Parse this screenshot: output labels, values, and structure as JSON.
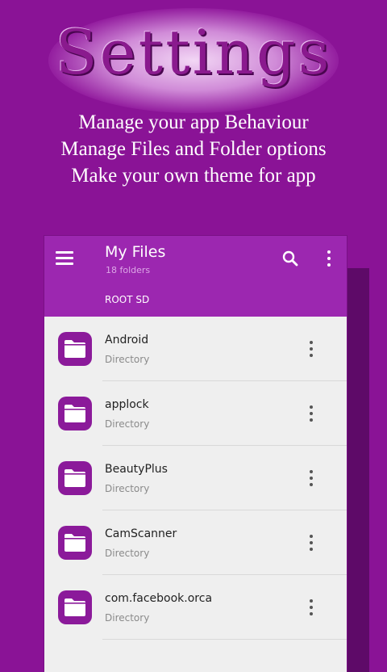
{
  "promo": {
    "title": "Settings",
    "lines": [
      "Manage your app Behaviour",
      "Manage Files and Folder options",
      "Make your own theme for app"
    ]
  },
  "appbar": {
    "title": "My Files",
    "subtitle": "18 folders",
    "breadcrumb": "ROOT SD",
    "icons": [
      "menu-icon",
      "search-icon",
      "more-vert-icon"
    ]
  },
  "colors": {
    "background": "#8a1396",
    "appbar": "#9c27b0",
    "folder_icon_bg": "#8b1a9a",
    "list_bg": "#efefef"
  },
  "files": [
    {
      "name": "Android",
      "type": "Directory"
    },
    {
      "name": "applock",
      "type": "Directory"
    },
    {
      "name": "BeautyPlus",
      "type": "Directory"
    },
    {
      "name": "CamScanner",
      "type": "Directory"
    },
    {
      "name": "com.facebook.orca",
      "type": "Directory"
    }
  ]
}
